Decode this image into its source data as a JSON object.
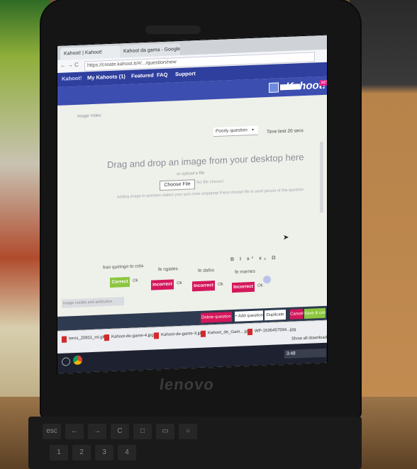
{
  "browser": {
    "tab_active": "Kahoot! | Kahoot!",
    "tab_second": "Kahoot da gama - Google...",
    "url": "https://create.kahoot.it/#/.../question/new"
  },
  "kahoot_nav": {
    "logo_small": "Kahoot!",
    "my_kahoots": "My Kahoots (1)",
    "featured": "Featured",
    "faq": "FAQ",
    "support": "Support"
  },
  "header": {
    "logo": "Kahoot!",
    "beta": "BETA"
  },
  "editor": {
    "small_tabs": "Image   Video",
    "question_type": "Poorly question",
    "time_limit": "Time limit   20 secs",
    "drag_text": "Drag and drop an image from your desktop here",
    "or_text": "or upload a file",
    "choose_file": "Choose File",
    "no_file": "No file chosen",
    "adding_text": "Adding image to question makes your quiz more engaging! Press choose file to send picture of this question"
  },
  "answers": [
    {
      "label": "fran quiringo to cola",
      "button": "Correct",
      "mark": "Ok"
    },
    {
      "label": "fe ngiales",
      "button": "Incorrect",
      "mark": "Ok"
    },
    {
      "label": "fe dafos",
      "button": "Incorrect",
      "mark": "Ok"
    },
    {
      "label": "fe marnes",
      "button": "Incorrect",
      "mark": "Ok"
    }
  ],
  "format_tools": "B I x² x₂ Ω",
  "image_credits": "Image credits and attribution",
  "actions": {
    "delete": "Delete question",
    "add": "+ Add question",
    "duplicate": "Duplicate",
    "cancel": "Cancel",
    "save": "Save & continue"
  },
  "downloads": [
    "teros_20811_mi.gif",
    "Kahoot-de-game-4.jpg",
    "Kahoot-de-game-3.jpg",
    "Kahoot_de_Gam....jpg",
    "WP-1536457594...jpg"
  ],
  "show_all": "Show all downloads...",
  "tray_time": "3:48",
  "laptop_brand": "lenovo",
  "colors": {
    "kahoot_nav": "#2f3f9e",
    "correct": "#8cc63f",
    "incorrect": "#d4175b",
    "save": "#8cc63f"
  }
}
